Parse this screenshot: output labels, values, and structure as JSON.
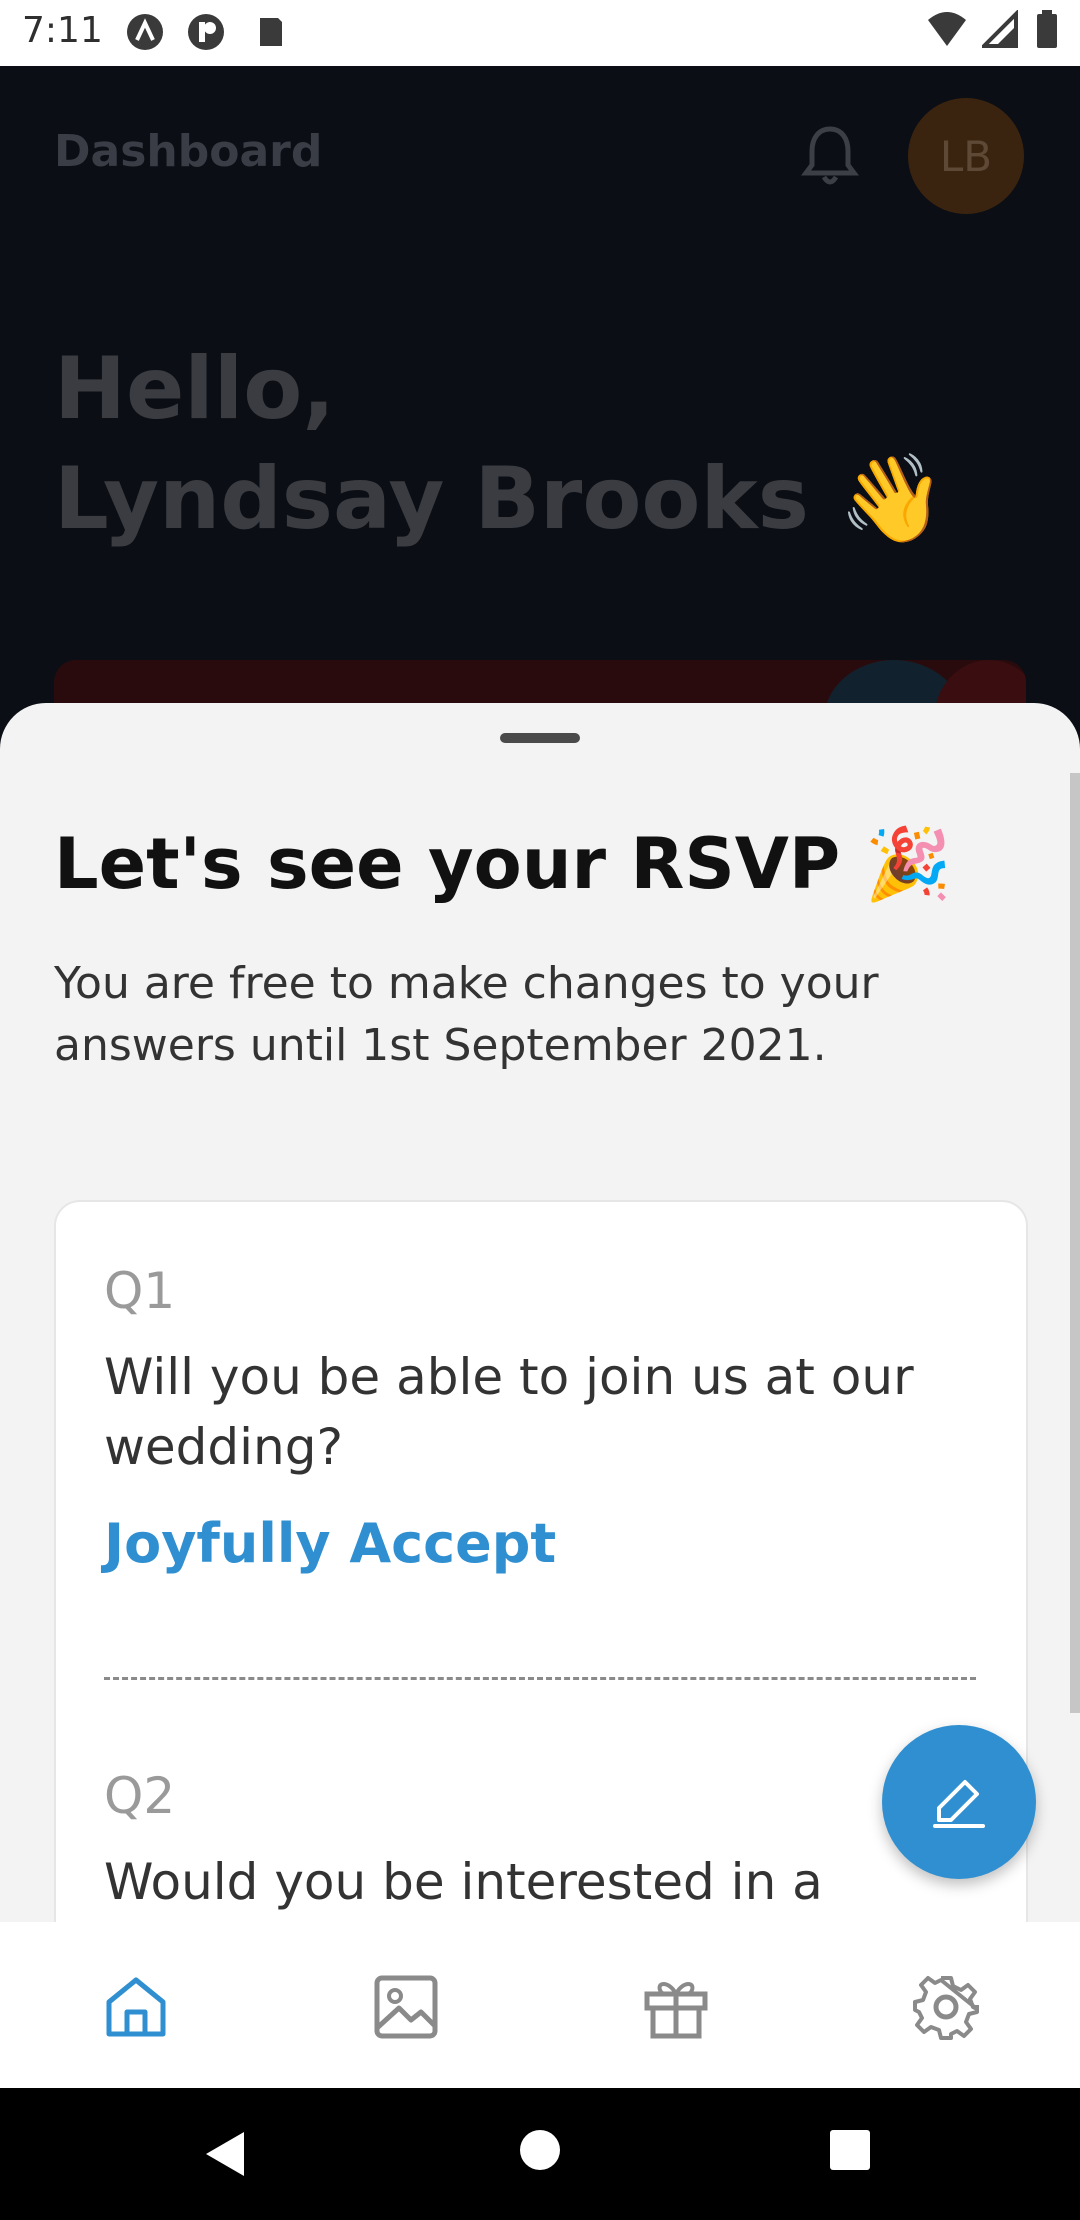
{
  "status_bar": {
    "time": "7:11"
  },
  "dashboard": {
    "title": "Dashboard",
    "avatar_initials": "LB",
    "greeting_line1": "Hello,",
    "greeting_line2": "Lyndsay Brooks 👋"
  },
  "sheet": {
    "title": "Let's see your RSVP 🎉",
    "subtitle": "You are free to make changes to your answers until 1st September 2021.",
    "questions": [
      {
        "label": "Q1",
        "text": "Will you be able to join us at our wedding?",
        "answer": "Joyfully Accept"
      },
      {
        "label": "Q2",
        "text": "Would you be interested in a"
      }
    ]
  },
  "icons": {
    "nav": [
      "home-icon",
      "gallery-icon",
      "gift-icon",
      "settings-icon"
    ],
    "fab": "edit-pencil-icon"
  },
  "colors": {
    "accent": "#2f8fd0",
    "sheet_bg": "#f3f3f3",
    "backdrop": "#0b0e14"
  }
}
